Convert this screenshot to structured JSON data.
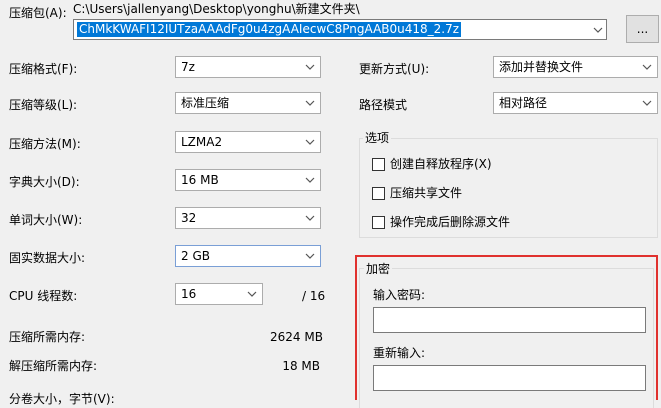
{
  "archive": {
    "label": "压缩包(A):",
    "path": "C:\\Users\\jallenyang\\Desktop\\yonghu\\新建文件夹\\",
    "filename": "ChMkKWAFI12IUTzaAAAdFg0u4zgAAIecwC8PngAAB0u418_2.7z",
    "browse_label": "..."
  },
  "left": {
    "format": {
      "label": "压缩格式(F):",
      "value": "7z"
    },
    "level": {
      "label": "压缩等级(L):",
      "value": "标准压缩"
    },
    "method": {
      "label": "压缩方法(M):",
      "value": "LZMA2"
    },
    "dict": {
      "label": "字典大小(D):",
      "value": "16 MB"
    },
    "word": {
      "label": "单词大小(W):",
      "value": "32"
    },
    "solid": {
      "label": "固实数据大小:",
      "value": "2 GB"
    },
    "threads": {
      "label": "CPU 线程数:",
      "value": "16",
      "total": "/ 16"
    },
    "mem_compress": {
      "label": "压缩所需内存:",
      "value": "2624 MB"
    },
    "mem_decompress": {
      "label": "解压缩所需内存:",
      "value": "18 MB"
    },
    "split": {
      "label": "分卷大小，字节(V):"
    }
  },
  "right": {
    "update": {
      "label": "更新方式(U):",
      "value": "添加并替换文件"
    },
    "pathmode": {
      "label": "路径模式",
      "value": "相对路径"
    },
    "options": {
      "title": "选项",
      "items": [
        "创建自释放程序(X)",
        "压缩共享文件",
        "操作完成后删除源文件"
      ]
    },
    "encryption": {
      "title": "加密",
      "password_label": "输入密码:",
      "reenter_label": "重新输入:"
    }
  },
  "colors": {
    "selection": "#0078d7",
    "highlight": "#e0312e"
  },
  "icons": [
    "chevron-down-icon",
    "spinner-icon"
  ]
}
